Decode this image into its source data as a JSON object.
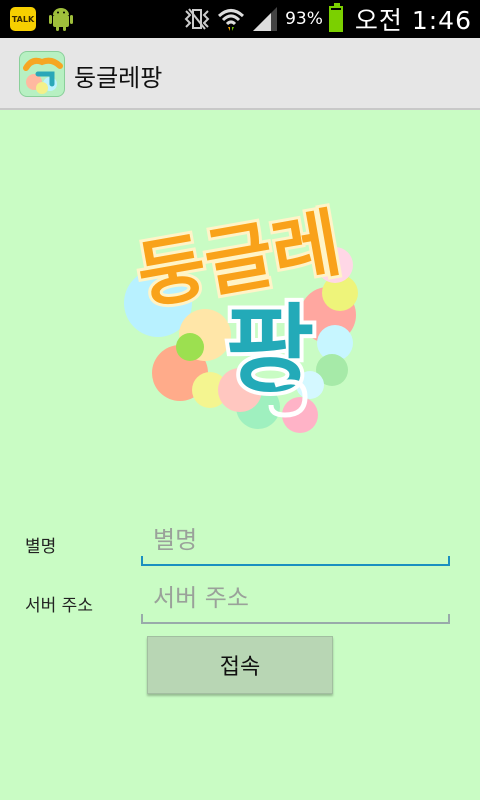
{
  "status_bar": {
    "notification_icons": [
      "kakaotalk-icon",
      "android-debug-icon"
    ],
    "kakaotalk_text": "TALK",
    "battery_percent": "93%",
    "battery_level": 0.93,
    "time": "오전 1:46"
  },
  "action_bar": {
    "title": "둥글레팡",
    "app_icon": "app-logo-icon"
  },
  "logo": {
    "text_top": "둥글레",
    "text_bottom": "팡"
  },
  "form": {
    "nickname": {
      "label": "별명",
      "placeholder": "별명",
      "value": ""
    },
    "server_address": {
      "label": "서버 주소",
      "placeholder": "서버 주소",
      "value": ""
    },
    "connect_label": "접속"
  },
  "colors": {
    "background": "#c9fcc4",
    "focus_accent": "#1a8fc0",
    "button": "#b8d6b4"
  }
}
